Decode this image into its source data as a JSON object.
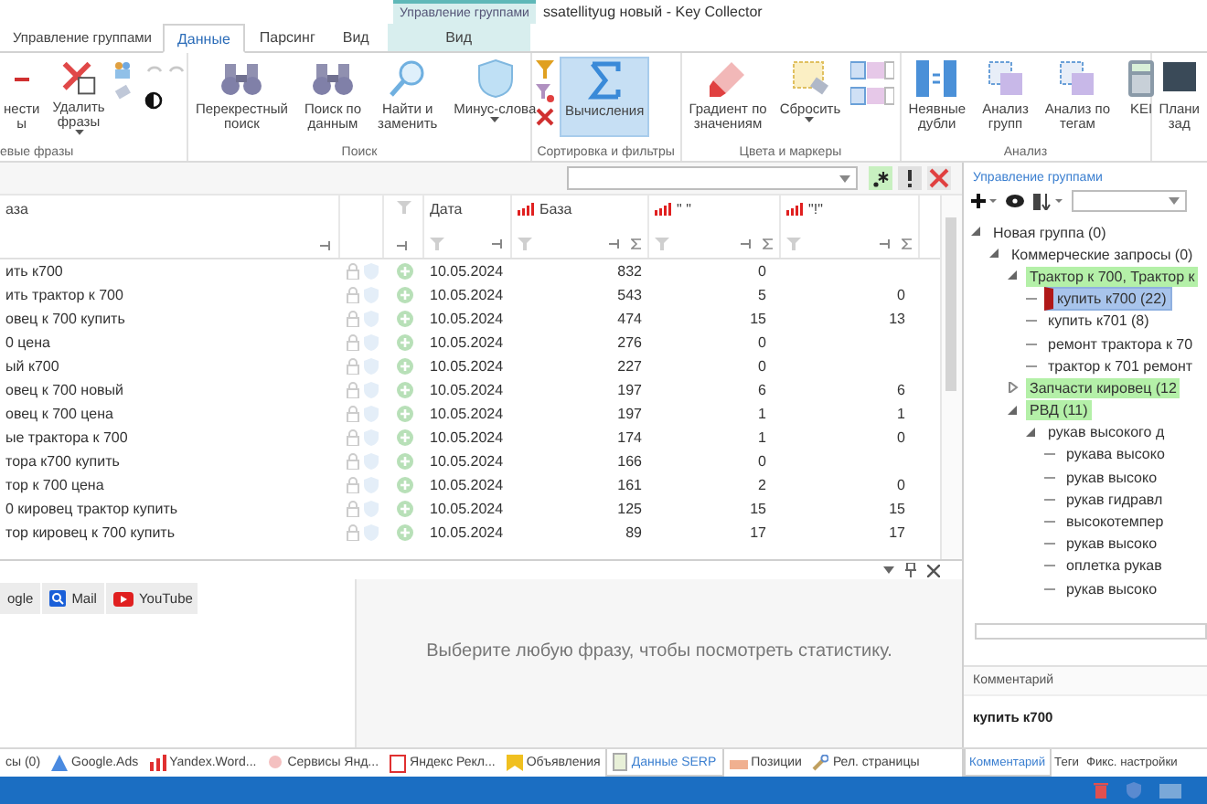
{
  "window": {
    "title": "ssatellityug новый - Key Collector",
    "context_header": "Управление группами"
  },
  "tabs": [
    {
      "label": "Управление группами",
      "selected": false,
      "contextual": false
    },
    {
      "label": "Данные",
      "selected": true,
      "contextual": false
    },
    {
      "label": "Парсинг",
      "selected": false,
      "contextual": false
    },
    {
      "label": "Вид",
      "selected": false,
      "contextual": false
    },
    {
      "label": "Вид",
      "selected": false,
      "contextual": true
    }
  ],
  "ribbon": [
    {
      "label": "евые фразы",
      "buttons": [
        {
          "lines": [
            "нести",
            "ы"
          ],
          "dropdown": false,
          "selected": false
        },
        {
          "lines": [
            "Удалить",
            "фразы"
          ],
          "dropdown": true,
          "selected": false
        }
      ]
    },
    {
      "label": "Поиск",
      "buttons": [
        {
          "lines": [
            "Перекрестный",
            "поиск"
          ],
          "dropdown": false,
          "selected": false
        },
        {
          "lines": [
            "Поиск по",
            "данным"
          ],
          "dropdown": false,
          "selected": false
        },
        {
          "lines": [
            "Найти и",
            "заменить"
          ],
          "dropdown": false,
          "selected": false
        },
        {
          "lines": [
            "Минус-слова"
          ],
          "dropdown": true,
          "selected": false
        }
      ]
    },
    {
      "label": "Сортировка и фильтры",
      "buttons": [
        {
          "lines": [
            "Вычисления"
          ],
          "dropdown": false,
          "selected": true
        }
      ]
    },
    {
      "label": "Цвета и маркеры",
      "buttons": [
        {
          "lines": [
            "Градиент по",
            "значениям"
          ],
          "dropdown": false,
          "selected": false
        },
        {
          "lines": [
            "Сбросить"
          ],
          "dropdown": true,
          "selected": false
        }
      ]
    },
    {
      "label": "Анализ",
      "buttons": [
        {
          "lines": [
            "Неявные",
            "дубли"
          ],
          "dropdown": false,
          "selected": false
        },
        {
          "lines": [
            "Анализ",
            "групп"
          ],
          "dropdown": false,
          "selected": false
        },
        {
          "lines": [
            "Анализ по",
            "тегам"
          ],
          "dropdown": false,
          "selected": false
        },
        {
          "lines": [
            "KEI"
          ],
          "dropdown": false,
          "selected": false
        }
      ]
    },
    {
      "buttons": [
        {
          "lines": [
            "Плани",
            "зад"
          ],
          "dropdown": false,
          "selected": false
        }
      ]
    }
  ],
  "table": {
    "columns": [
      "аза",
      "Дата",
      "База",
      "\" \"",
      "\"!\""
    ],
    "rows": [
      {
        "cells": [
          "ить к700",
          "10.05.2024",
          "832",
          "0"
        ]
      },
      {
        "cells": [
          "ить трактор к 700",
          "10.05.2024",
          "543",
          "5",
          "0"
        ]
      },
      {
        "cells": [
          "овец к 700 купить",
          "10.05.2024",
          "474",
          "15",
          "13"
        ]
      },
      {
        "cells": [
          "0 цена",
          "10.05.2024",
          "276",
          "0"
        ]
      },
      {
        "cells": [
          "ый к700",
          "10.05.2024",
          "227",
          "0"
        ]
      },
      {
        "cells": [
          "овец к 700 новый",
          "10.05.2024",
          "197",
          "6",
          "6"
        ]
      },
      {
        "cells": [
          "овец к 700 цена",
          "10.05.2024",
          "197",
          "1",
          "1"
        ]
      },
      {
        "cells": [
          "ые трактора к 700",
          "10.05.2024",
          "174",
          "1",
          "0"
        ]
      },
      {
        "cells": [
          "тора к700 купить",
          "10.05.2024",
          "166",
          "0"
        ]
      },
      {
        "cells": [
          "тор к 700 цена",
          "10.05.2024",
          "161",
          "2",
          "0"
        ]
      },
      {
        "cells": [
          "0 кировец трактор купить",
          "10.05.2024",
          "125",
          "15",
          "15"
        ]
      },
      {
        "cells": [
          "тор кировец к 700 купить",
          "10.05.2024",
          "89",
          "17",
          "17"
        ]
      }
    ]
  },
  "groups_panel": {
    "title": "Управление группами",
    "tree": [
      {
        "label": "Новая группа (0)",
        "selected": false,
        "expanded": true,
        "children": [
          {
            "label": "Коммерческие запросы (0)",
            "selected": false,
            "expanded": true,
            "children": [
              {
                "label": "Трактор к 700, Трактор к",
                "selected": false,
                "expanded": true,
                "color": "#b4f0a8",
                "children": [
                  {
                    "label": "купить к700 (22)",
                    "selected": true,
                    "marker": true
                  },
                  {
                    "label": "купить к701 (8)",
                    "selected": false
                  },
                  {
                    "label": "ремонт трактора к 70",
                    "selected": false
                  },
                  {
                    "label": "трактор к 701 ремонт",
                    "selected": false
                  }
                ]
              },
              {
                "label": "Запчасти кировец (12",
                "selected": false,
                "expanded": false,
                "color": "#b4f0a8"
              },
              {
                "label": "РВД (11)",
                "selected": false,
                "expanded": true,
                "color": "#b4f0a8",
                "children": [
                  {
                    "label": "рукав высокого д",
                    "selected": false,
                    "expanded": true,
                    "children": [
                      {
                        "label": "рукава высоко",
                        "selected": false
                      },
                      {
                        "label": "рукав высоко",
                        "selected": false
                      },
                      {
                        "label": "рукав гидравл",
                        "selected": false
                      },
                      {
                        "label": "высокотемпер",
                        "selected": false
                      },
                      {
                        "label": "рукав высоко",
                        "selected": false
                      },
                      {
                        "label": "оплетка рукав",
                        "selected": false
                      },
                      {
                        "label": "рукав высоко",
                        "selected": false
                      }
                    ]
                  }
                ]
              }
            ]
          }
        ]
      }
    ]
  },
  "bookmarks": [
    "ogle",
    "Mail",
    "YouTube"
  ],
  "stats_message": "Выберите любую фразу, чтобы посмотреть статистику.",
  "comment": {
    "title": "Комментарий",
    "text": "купить к700"
  },
  "bottom_tabs": [
    {
      "label": "сы (0)",
      "selected": false
    },
    {
      "label": "Google.Ads",
      "selected": false
    },
    {
      "label": "Yandex.Word...",
      "selected": false
    },
    {
      "label": "Сервисы Янд...",
      "selected": false
    },
    {
      "label": "Яндекс Рекл...",
      "selected": false
    },
    {
      "label": "Объявления",
      "selected": false
    },
    {
      "label": "Данные SERP",
      "selected": true
    },
    {
      "label": "Позиции",
      "selected": false
    },
    {
      "label": "Рел. страницы",
      "selected": false
    }
  ],
  "right_tabs": [
    {
      "label": "Комментарий",
      "selected": true
    },
    {
      "label": "Теги",
      "selected": false
    },
    {
      "label": "Фикс. настройки",
      "selected": false
    }
  ]
}
